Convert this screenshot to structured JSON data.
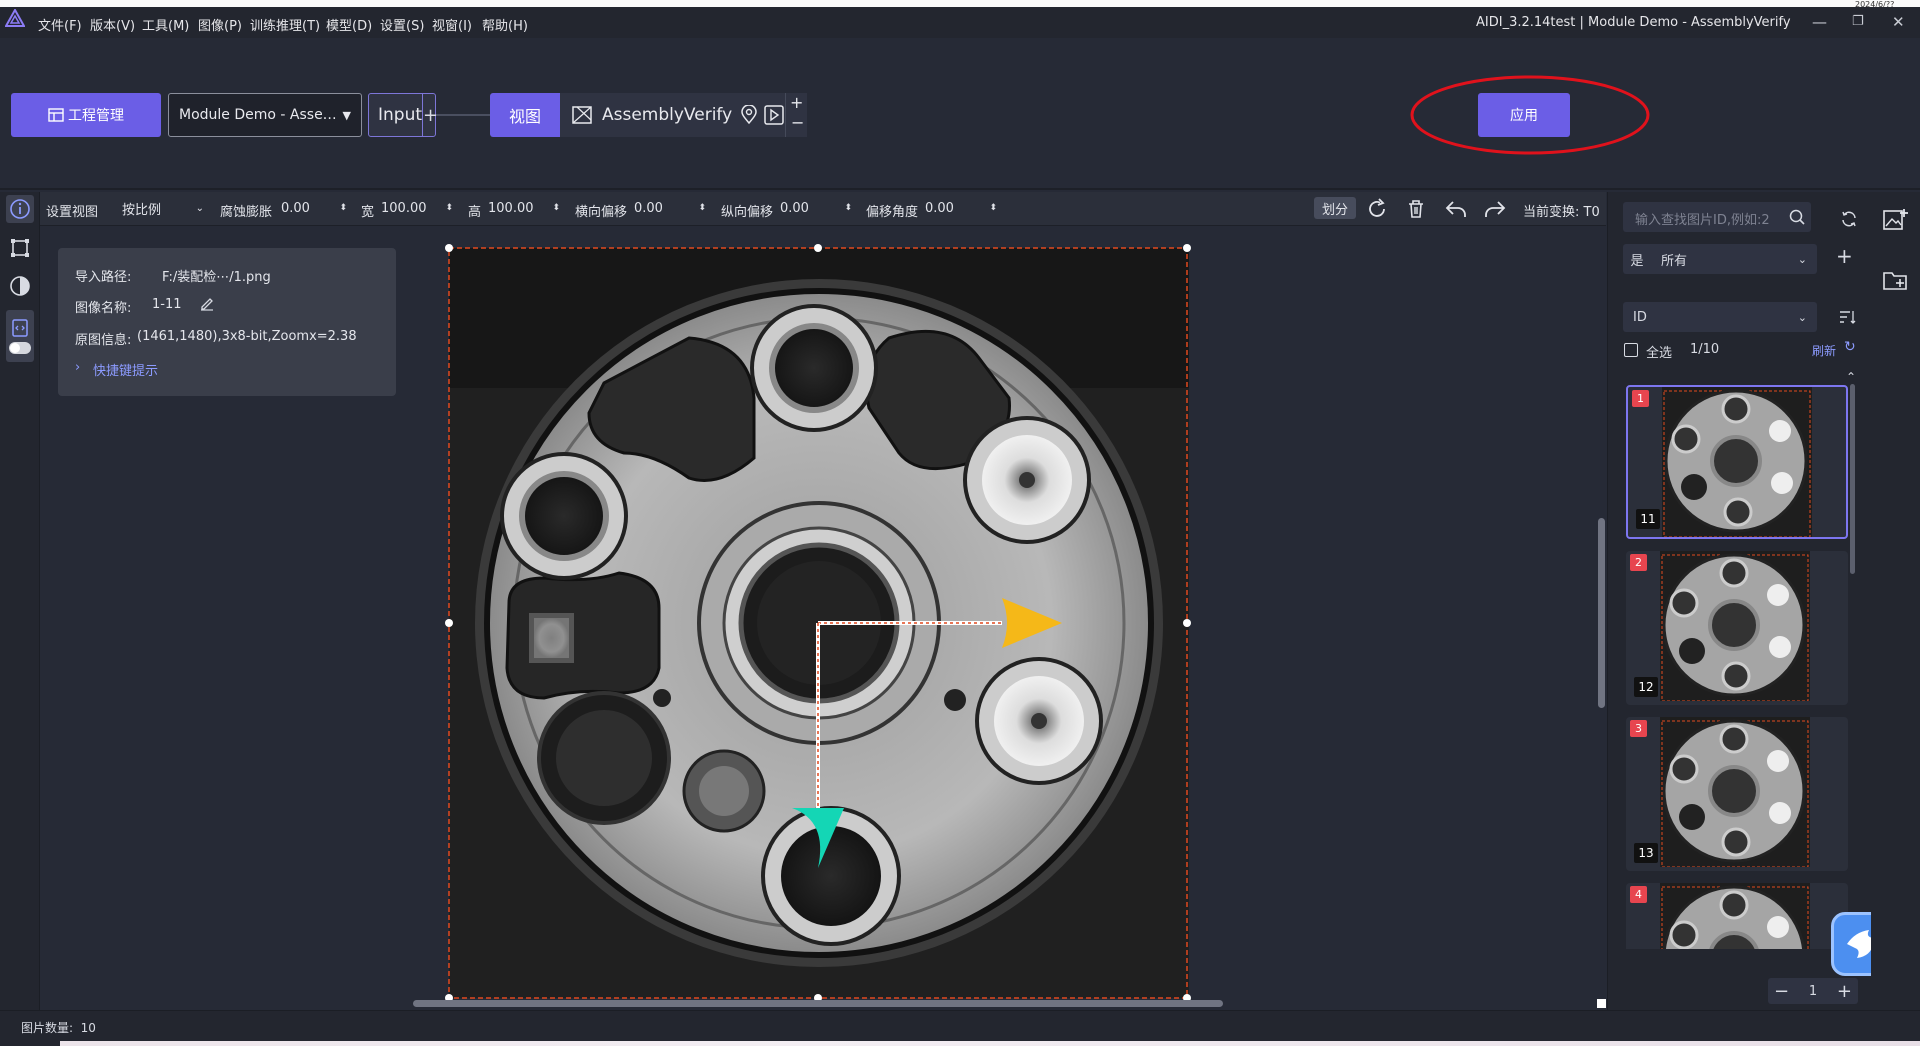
{
  "app": {
    "logo": "triangle-logo",
    "window_title": "AIDI_3.2.14test | Module Demo - AssemblyVerify",
    "clock_partial": "2024/6/??",
    "menu": [
      "文件(F)",
      "版本(V)",
      "工具(M)",
      "图像(P)",
      "训练推理(T)",
      "模型(D)",
      "设置(S)",
      "视窗(I)",
      "帮助(H)"
    ]
  },
  "workflow": {
    "project_button": "工程管理",
    "project_select": "Module Demo - Asse…",
    "input_node": "Input",
    "view_node": "视图",
    "module_node": "AssemblyVerify",
    "apply_button": "应用",
    "accent": "#6b5ee6",
    "highlight_color": "#e0121c"
  },
  "toolbar": {
    "set_view": "设置视图",
    "scale_mode": "按比例",
    "erode_label": "腐蚀膨胀",
    "erode_value": "0.00",
    "width_label": "宽",
    "width_value": "100.00",
    "height_label": "高",
    "height_value": "100.00",
    "hoffset_label": "横向偏移",
    "hoffset_value": "0.00",
    "voffset_label": "纵向偏移",
    "voffset_value": "0.00",
    "angle_label": "偏移角度",
    "angle_value": "0.00",
    "divide_button": "划分",
    "transform_label": "当前变换: T0"
  },
  "info": {
    "path_label": "导入路径:",
    "path_value": "F:/装配检⋯/1.png",
    "name_label": "图像名称:",
    "name_value": "1-11",
    "meta_label": "原图信息:",
    "meta_value": "(1461,1480),3x8-bit,Zoomx=2.38",
    "shortcut_link": "快捷键提示"
  },
  "right_panel": {
    "search_placeholder": "输入查找图片ID,例如:2",
    "filter_prefix": "是",
    "filter_value": "所有",
    "sort_value": "ID",
    "select_all": "全选",
    "count": "1/10",
    "refresh": "刷新",
    "thumbs": [
      {
        "index": "1",
        "id": "11"
      },
      {
        "index": "2",
        "id": "12"
      },
      {
        "index": "3",
        "id": "13"
      },
      {
        "index": "4",
        "id": ""
      }
    ],
    "page": "1"
  },
  "status": {
    "image_count": "图片数量:  10"
  },
  "colors": {
    "arrow_x": "#f5b818",
    "arrow_y": "#14d6b5",
    "roi": "#e0491f"
  }
}
